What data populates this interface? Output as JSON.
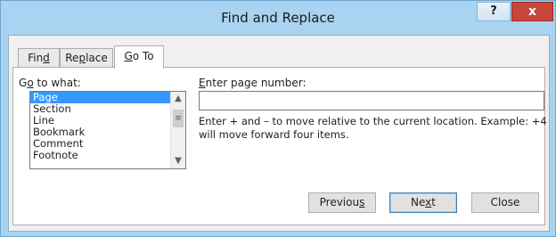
{
  "window": {
    "title": "Find and Replace",
    "help_glyph": "?",
    "close_glyph": "x"
  },
  "tabs": [
    {
      "label_pre": "Fin",
      "label_u": "d",
      "label_post": "",
      "active": false
    },
    {
      "label_pre": "Re",
      "label_u": "p",
      "label_post": "lace",
      "active": false
    },
    {
      "label_pre": "",
      "label_u": "G",
      "label_post": "o To",
      "active": true
    }
  ],
  "goto": {
    "label_pre": "G",
    "label_u": "o",
    "label_post": " to what:",
    "items": [
      "Page",
      "Section",
      "Line",
      "Bookmark",
      "Comment",
      "Footnote"
    ],
    "selected_index": 0
  },
  "page_number": {
    "label_pre": "",
    "label_u": "E",
    "label_post": "nter page number:",
    "value": "",
    "hint": "Enter + and – to move relative to the current location. Example: +4 will move forward four items."
  },
  "buttons": {
    "previous": {
      "pre": "Previou",
      "u": "s",
      "post": ""
    },
    "next": {
      "pre": "Ne",
      "u": "x",
      "post": "t"
    },
    "close": {
      "pre": "Close",
      "u": "",
      "post": ""
    }
  },
  "colors": {
    "window_frame": "#a9d3f1",
    "close_button": "#c7463b",
    "selection": "#3399ff"
  }
}
